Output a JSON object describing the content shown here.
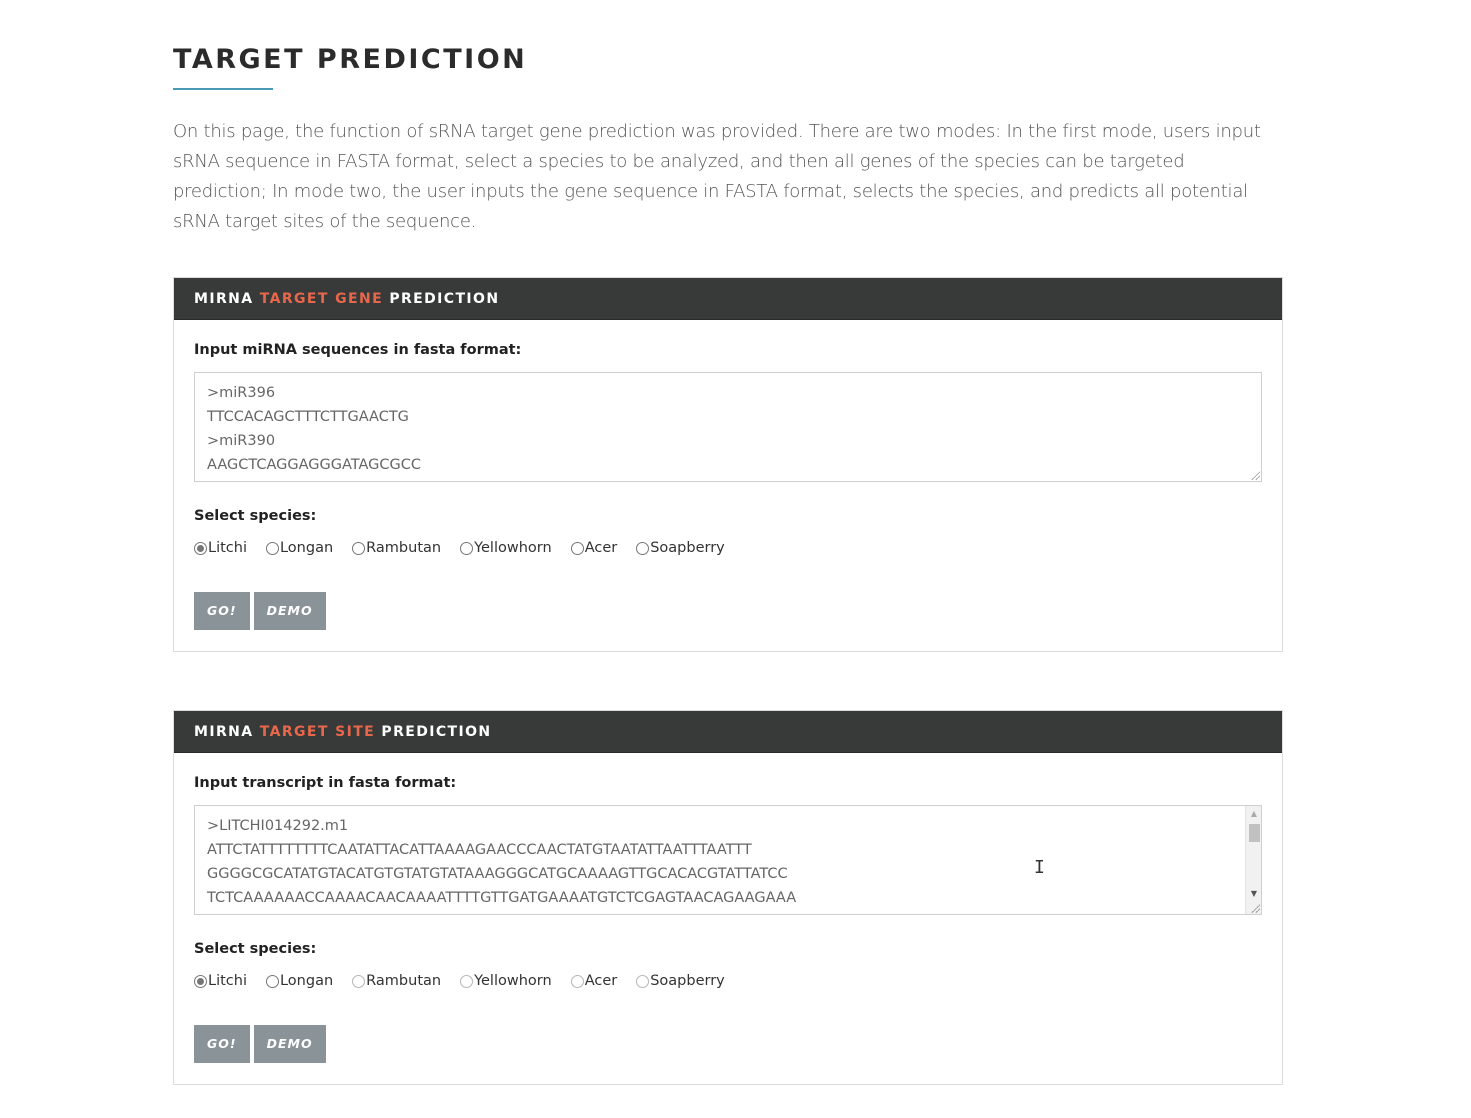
{
  "page": {
    "title": "TARGET PREDICTION",
    "intro": "On this page, the function of sRNA target gene prediction was provided. There are two modes: In the first mode, users input sRNA sequence in FASTA format, select a species to be analyzed, and then all genes of the species can be targeted prediction; In mode two, the user inputs the gene sequence in FASTA format, selects the species, and predicts all potential sRNA target sites of the sequence."
  },
  "panels": [
    {
      "title_pre": "MIRNA",
      "title_accent": "TARGET GENE",
      "title_post": "PREDICTION",
      "input_label": "Input miRNA sequences in fasta format:",
      "sequence_lines": [
        ">miR396",
        "TTCCACAGCTTTCTTGAACTG",
        ">miR390",
        "AAGCTCAGGAGGGATAGCGCC"
      ],
      "species_label": "Select species:",
      "species": [
        "Litchi",
        "Longan",
        "Rambutan",
        "Yellowhorn",
        "Acer",
        "Soapberry"
      ],
      "selected_species": "Litchi",
      "go_label": "GO!",
      "demo_label": "DEMO"
    },
    {
      "title_pre": "MIRNA",
      "title_accent": "TARGET SITE",
      "title_post": "PREDICTION",
      "input_label": "Input transcript in fasta format:",
      "sequence_lines": [
        ">LITCHI014292.m1",
        "ATTCTATTTTTTTTCAATATTACATTAAAAGAACCCAACTATGTAATATTAATTTAATTT",
        "GGGGCGCATATGTACATGTGTATGTATAAAGGGCATGCAAAAGTTGCACACGTATTATCC",
        "TCTCAAAAAACCAAAACAACAAAATTTTGTTGATGAAAATGTCTCGAGTAACAGAAGAAA"
      ],
      "species_label": "Select species:",
      "species": [
        "Litchi",
        "Longan",
        "Rambutan",
        "Yellowhorn",
        "Acer",
        "Soapberry"
      ],
      "selected_species": "Litchi",
      "go_label": "GO!",
      "demo_label": "DEMO"
    }
  ],
  "colors": {
    "header_bg": "#383a3a",
    "accent": "#e8674b",
    "underline": "#4a9bb5",
    "button_bg": "#8a9397"
  }
}
